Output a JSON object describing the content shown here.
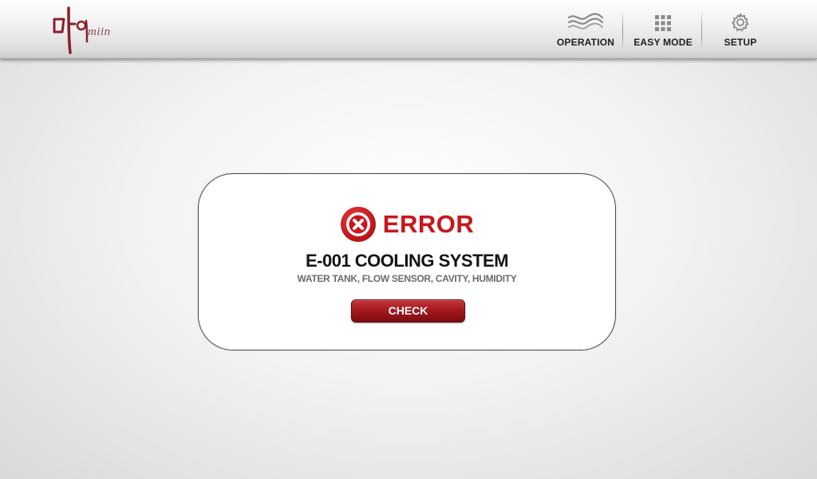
{
  "header": {
    "logo_text": "miin",
    "nav": [
      {
        "label": "OPERATION",
        "icon": "wave-icon"
      },
      {
        "label": "EASY MODE",
        "icon": "grid-icon"
      },
      {
        "label": "SETUP",
        "icon": "gear-icon"
      }
    ]
  },
  "dialog": {
    "title": "ERROR",
    "icon": "error-x-icon",
    "code": "E-001 COOLING SYSTEM",
    "detail": "WATER TANK, FLOW SENSOR, CAVITY, HUMIDITY",
    "button_label": "CHECK"
  },
  "colors": {
    "accent": "#c8171c",
    "button": "#a0181d",
    "logo": "#8a1f2c"
  }
}
